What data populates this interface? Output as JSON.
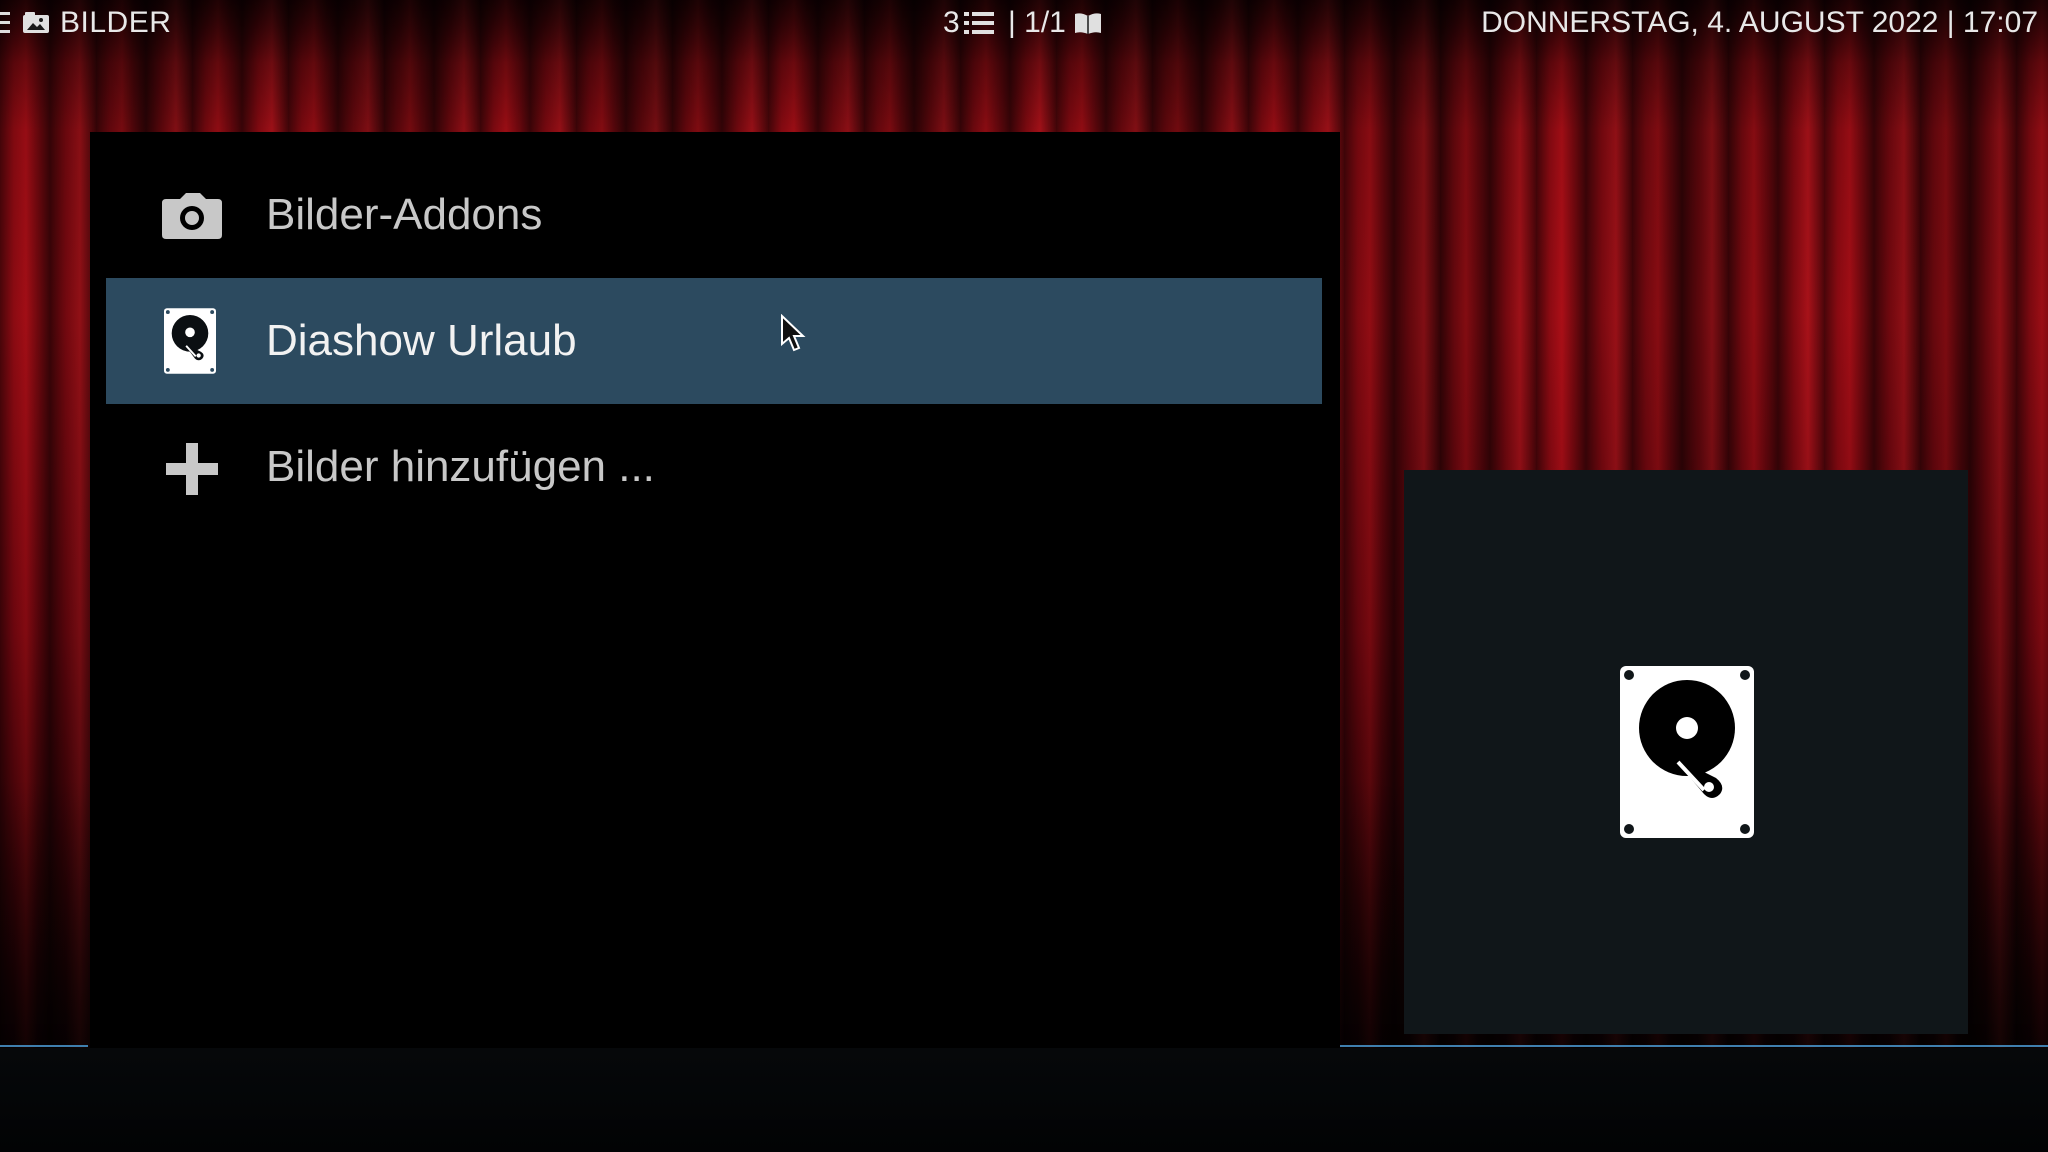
{
  "header": {
    "app_title": "BILDER",
    "item_count": "3",
    "page_info": "| 1/1",
    "datetime": "DONNERSTAG, 4. AUGUST 2022 | 17:07"
  },
  "list": {
    "items": [
      {
        "label": "Bilder-Addons",
        "icon": "camera-icon",
        "selected": false
      },
      {
        "label": "Diashow Urlaub",
        "icon": "hard-drive-icon",
        "selected": true
      },
      {
        "label": "Bilder hinzufügen ...",
        "icon": "plus-icon",
        "selected": false
      }
    ]
  },
  "preview": {
    "icon": "hard-drive-icon"
  },
  "colors": {
    "selection": "#2c4a5f",
    "accent_line": "#3f7fae",
    "curtain": "#a10c15"
  }
}
